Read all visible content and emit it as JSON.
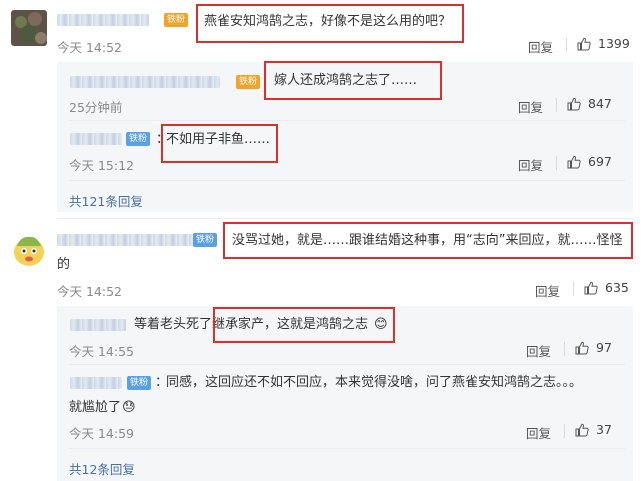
{
  "colors": {
    "highlight": "#d9302c",
    "link": "#476fa8",
    "badge_blue": "#5aa0e6",
    "badge_orange": "#f2a42a"
  },
  "icons": {
    "like": "thumb-up-icon",
    "fan_badge": "iron-fan-badge-icon"
  },
  "comment1": {
    "badge": "铁粉",
    "text": "燕雀安知鸿鹄之志，好像不是这么用的吧？",
    "time": "今天 14:52",
    "reply_label": "回复",
    "likes": "1399",
    "replies": [
      {
        "badge": "铁粉",
        "text": "嫁人还成鸿鹄之志了……",
        "time": "25分钟前",
        "reply_label": "回复",
        "likes": "847"
      },
      {
        "badge": "铁粉",
        "text": "不如用子非鱼……",
        "time": "今天 15:12",
        "reply_label": "回复",
        "likes": "697"
      }
    ],
    "more_replies": "共121条回复"
  },
  "comment2": {
    "badge": "铁粉",
    "text_line1": "没骂过她，就是……跟谁结婚这种事，用“志向”来回应，就……怪怪",
    "text_line2": "的",
    "time": "今天 14:52",
    "reply_label": "回复",
    "likes": "635",
    "replies": [
      {
        "text": "等着老头死了继承家产，这就是鸿鹄之志",
        "emoji": "😊",
        "time": "今天 14:55",
        "reply_label": "回复",
        "likes": "97"
      },
      {
        "badge": "铁粉",
        "text_line1": "同感，这回应还不如不回应，本来觉得没啥，问了燕雀安知鸿鹄之志。。。",
        "text_line2": "就尴尬了",
        "emoji": "😓",
        "time": "今天 14:59",
        "reply_label": "回复",
        "likes": "37"
      }
    ],
    "more_replies": "共12条回复"
  }
}
